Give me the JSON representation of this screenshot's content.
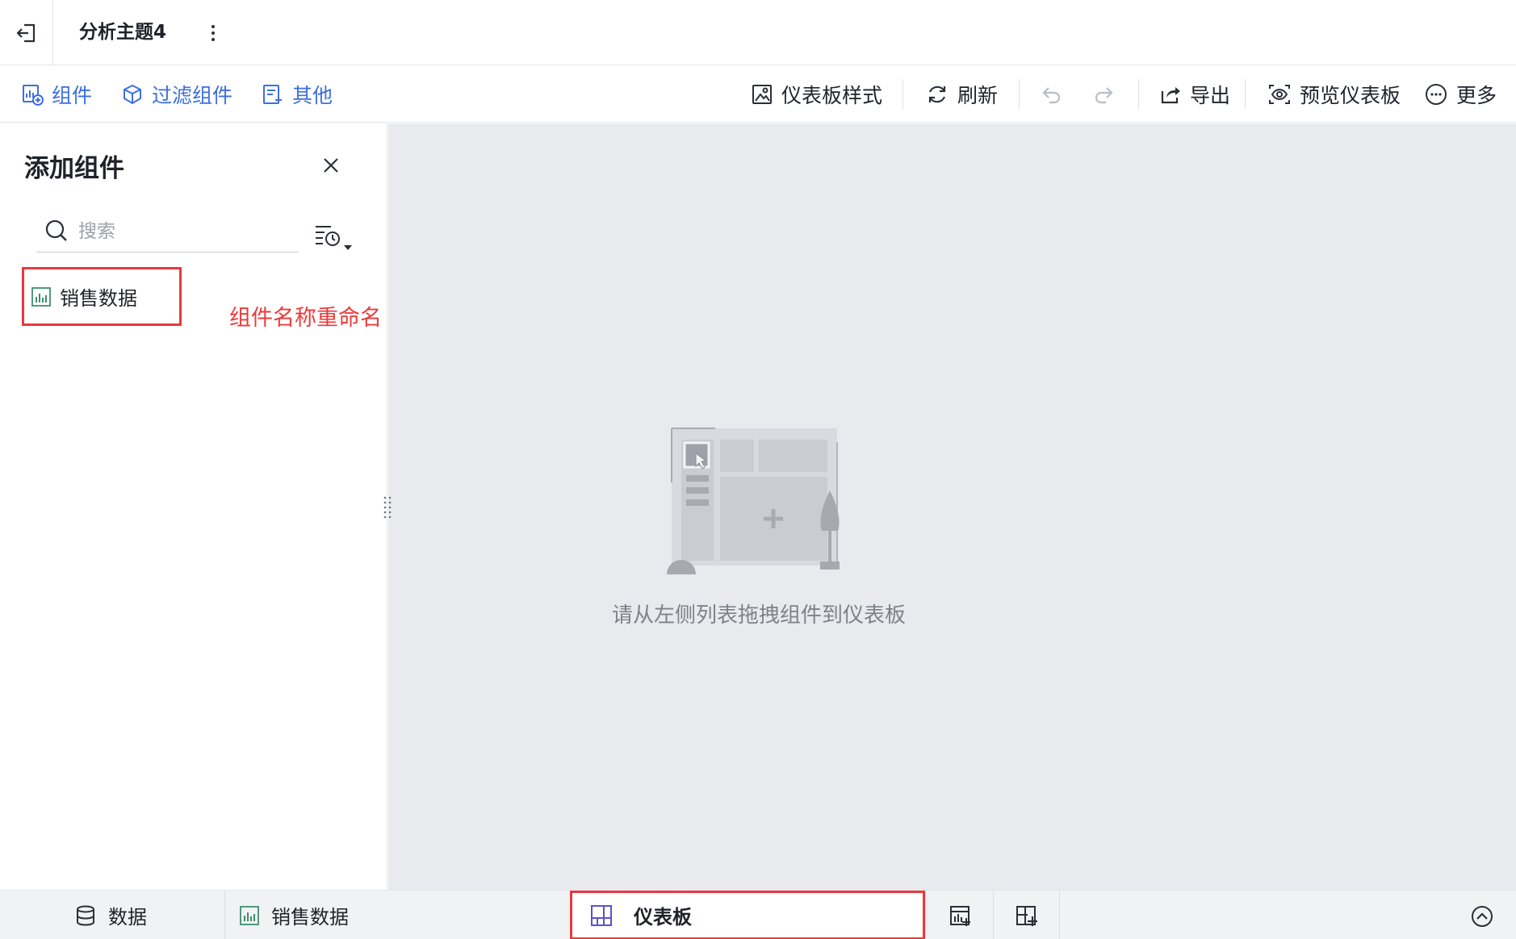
{
  "topbar": {
    "title": "分析主题4",
    "exit_icon": "exit-icon",
    "more_icon": "vertical-dots-icon"
  },
  "toolbar": {
    "component_label": "组件",
    "filter_component_label": "过滤组件",
    "other_label": "其他",
    "dashboard_style_label": "仪表板样式",
    "refresh_label": "刷新",
    "export_label": "导出",
    "preview_label": "预览仪表板",
    "more_label": "更多",
    "accent_color": "#3d6fe0"
  },
  "panel": {
    "title": "添加组件",
    "search_placeholder": "搜索",
    "items": [
      {
        "label": "销售数据",
        "icon": "bar-chart-icon"
      }
    ],
    "annotation": "组件名称重命名",
    "highlight_color": "#e8393d"
  },
  "canvas": {
    "empty_text": "请从左侧列表拖拽组件到仪表板"
  },
  "bottombar": {
    "tabs": [
      {
        "label": "数据",
        "icon": "database-icon"
      },
      {
        "label": "销售数据",
        "icon": "bar-chart-icon"
      },
      {
        "label": "仪表板",
        "icon": "dashboard-icon",
        "active": true
      }
    ]
  }
}
